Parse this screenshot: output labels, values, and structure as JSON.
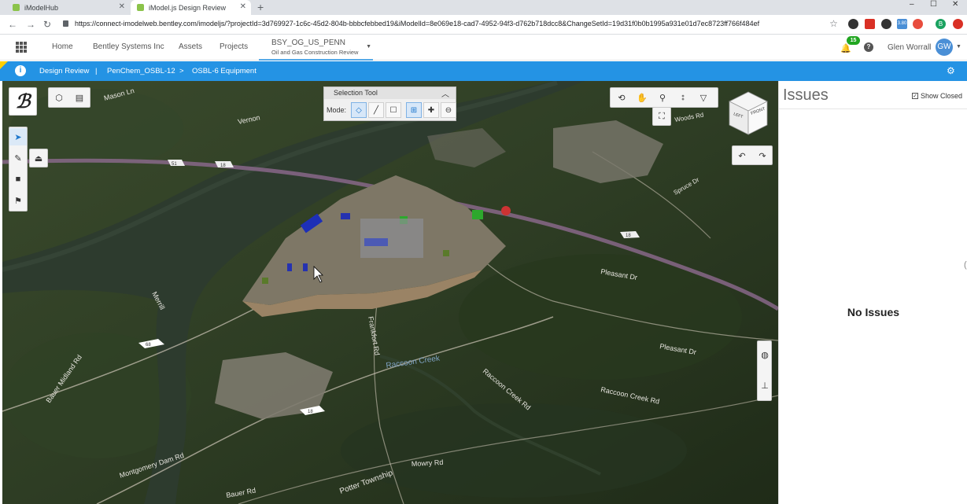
{
  "browser": {
    "tabs": [
      {
        "title": "iModelHub",
        "active": false
      },
      {
        "title": "iModel.js Design Review",
        "active": true
      }
    ],
    "new_tab": "+",
    "window_controls": [
      "–",
      "☐",
      "✕"
    ],
    "url": "https://connect-imodelweb.bentley.com/imodeljs/?projectId=3d769927-1c6c-45d2-804b-bbbcfebbed19&iModelId=8e069e18-cad7-4952-94f3-d762b718dcc8&ChangeSetId=19d31f0b0b1995a931e01d7ec8723ff766f484ef",
    "extensions": [
      {
        "icon": "star-icon",
        "color": "#5f6368"
      },
      {
        "icon": "extension-dark-icon",
        "color": "#333333"
      },
      {
        "icon": "pdf-icon",
        "color": "#d93025"
      },
      {
        "icon": "extension-dark-icon",
        "color": "#333333"
      },
      {
        "icon": "extension-blue-icon",
        "color": "#4a8fd6"
      },
      {
        "icon": "extension-red-icon",
        "color": "#e84c3d"
      },
      {
        "icon": "profile-b-icon",
        "color": "#1aa260",
        "label": "B"
      },
      {
        "icon": "extension-red-icon",
        "color": "#d93025"
      }
    ],
    "badge_text": "3.80"
  },
  "app_header": {
    "nav": [
      "Home",
      "Bentley Systems Inc",
      "Assets",
      "Projects"
    ],
    "project_name": "BSY_OG_US_PENN",
    "project_subtitle": "Oil and Gas Construction Review",
    "notification_count": "15",
    "help": "?",
    "user_name": "Glen Worrall",
    "user_initials": "GW"
  },
  "breadcrumb": {
    "items": [
      "Design Review",
      "PenChem_OSBL-12",
      "OSBL-6 Equipment"
    ],
    "separators": [
      "|",
      ">"
    ]
  },
  "selection_tool": {
    "title": "Selection Tool",
    "mode_label": "Mode:"
  },
  "cube": {
    "left": "LEFT",
    "front": "FRONT"
  },
  "map_labels": [
    "Mason Ln",
    "Vernon",
    "Merrill",
    "Pleasant Dr",
    "Pleasant Dr",
    "Raccoon Creek",
    "Raccoon Creek Rd",
    "Raccoon Creek Rd",
    "Mowry Rd",
    "Montgomery Dam Rd",
    "Bauer Rd",
    "Potter Township",
    "Frankfort Rd",
    "Bauer Midland Rd",
    "Raccoon Creek",
    "Woods Rd",
    "Spruce Dr"
  ],
  "road_shields": [
    "51",
    "18",
    "68",
    "18",
    "18",
    "168"
  ],
  "issues": {
    "title": "Issues",
    "show_closed_label": "Show Closed",
    "show_closed_checked": true,
    "empty_text": "No Issues"
  },
  "colors": {
    "accent": "#2493e4",
    "badge": "#21a621",
    "avatar": "#4a8fd6"
  }
}
